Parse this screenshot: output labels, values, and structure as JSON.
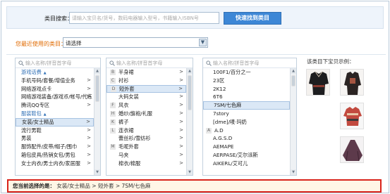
{
  "search": {
    "label": "类目搜索：",
    "placeholder": "请输入宝贝名/货号，数码电器输入型号，书籍输入ISBN号",
    "button": "快速找到类目"
  },
  "recent": {
    "label": "您最近使用的类目：",
    "value": "请选择"
  },
  "column_search_placeholder": "输入名称/拼音首字母",
  "col1": {
    "items": [
      {
        "label": "游戏话费",
        "type": "group"
      },
      {
        "label": "手机号码/套餐/增值业务",
        "type": "item"
      },
      {
        "label": "网络游戏点卡",
        "type": "item"
      },
      {
        "label": "网络游戏装备/游戏币/帐号/代练",
        "type": "item"
      },
      {
        "label": "腾讯QQ专区",
        "type": "item"
      },
      {
        "label": "服装鞋包",
        "type": "group"
      },
      {
        "label": "女装/女士精品",
        "type": "item"
      },
      {
        "label": "流行男鞋",
        "type": "item"
      },
      {
        "label": "男装",
        "type": "item"
      },
      {
        "label": "服饰配件/皮带/帽子/围巾",
        "type": "item"
      },
      {
        "label": "箱包皮具/热销女包/男包",
        "type": "item"
      },
      {
        "label": "女士内衣/男士内衣/家居服",
        "type": "item"
      }
    ]
  },
  "col2": {
    "items": [
      {
        "letter": "B",
        "label": "半身裙"
      },
      {
        "letter": "C",
        "label": "衬衫"
      },
      {
        "letter": "D",
        "label": "短外套"
      },
      {
        "letter": "",
        "label": "大码女装"
      },
      {
        "letter": "F",
        "label": "风衣"
      },
      {
        "letter": "H",
        "label": "婚纱/旗袍/礼服"
      },
      {
        "letter": "K",
        "label": "裤子"
      },
      {
        "letter": "L",
        "label": "连衣裙"
      },
      {
        "letter": "",
        "label": "蕾丝衫/雪纺衫"
      },
      {
        "letter": "M",
        "label": "毛呢外套"
      },
      {
        "letter": "",
        "label": "马夹"
      },
      {
        "letter": "",
        "label": "棉衣/棉服"
      }
    ]
  },
  "col3": {
    "items": [
      {
        "letter": "",
        "label": "100F1/百分之一"
      },
      {
        "letter": "",
        "label": "23区"
      },
      {
        "letter": "",
        "label": "2K12"
      },
      {
        "letter": "",
        "label": "6T6"
      },
      {
        "letter": "",
        "label": "7SM/七色麻"
      },
      {
        "letter": "",
        "label": "7story"
      },
      {
        "letter": "",
        "label": "[dme]/唛·玛奶"
      },
      {
        "letter": "A",
        "label": "A.D"
      },
      {
        "letter": "",
        "label": "A.G.S.D"
      },
      {
        "letter": "",
        "label": "AEMAPE"
      },
      {
        "letter": "",
        "label": "AERPASE/艾尔派斯"
      },
      {
        "letter": "",
        "label": "AIKERL/艾可儿"
      }
    ]
  },
  "preview": {
    "label": "该类目下宝贝示例："
  },
  "current": {
    "label": "您当前选择的是：",
    "path": "女装/女士精品 > 短外套 > 7SM/七色麻"
  },
  "colors": {
    "accent": "#3d87d6",
    "selection": "#dbe8f6",
    "alert_border": "#d9241b",
    "recent_label": "#e06a00"
  }
}
